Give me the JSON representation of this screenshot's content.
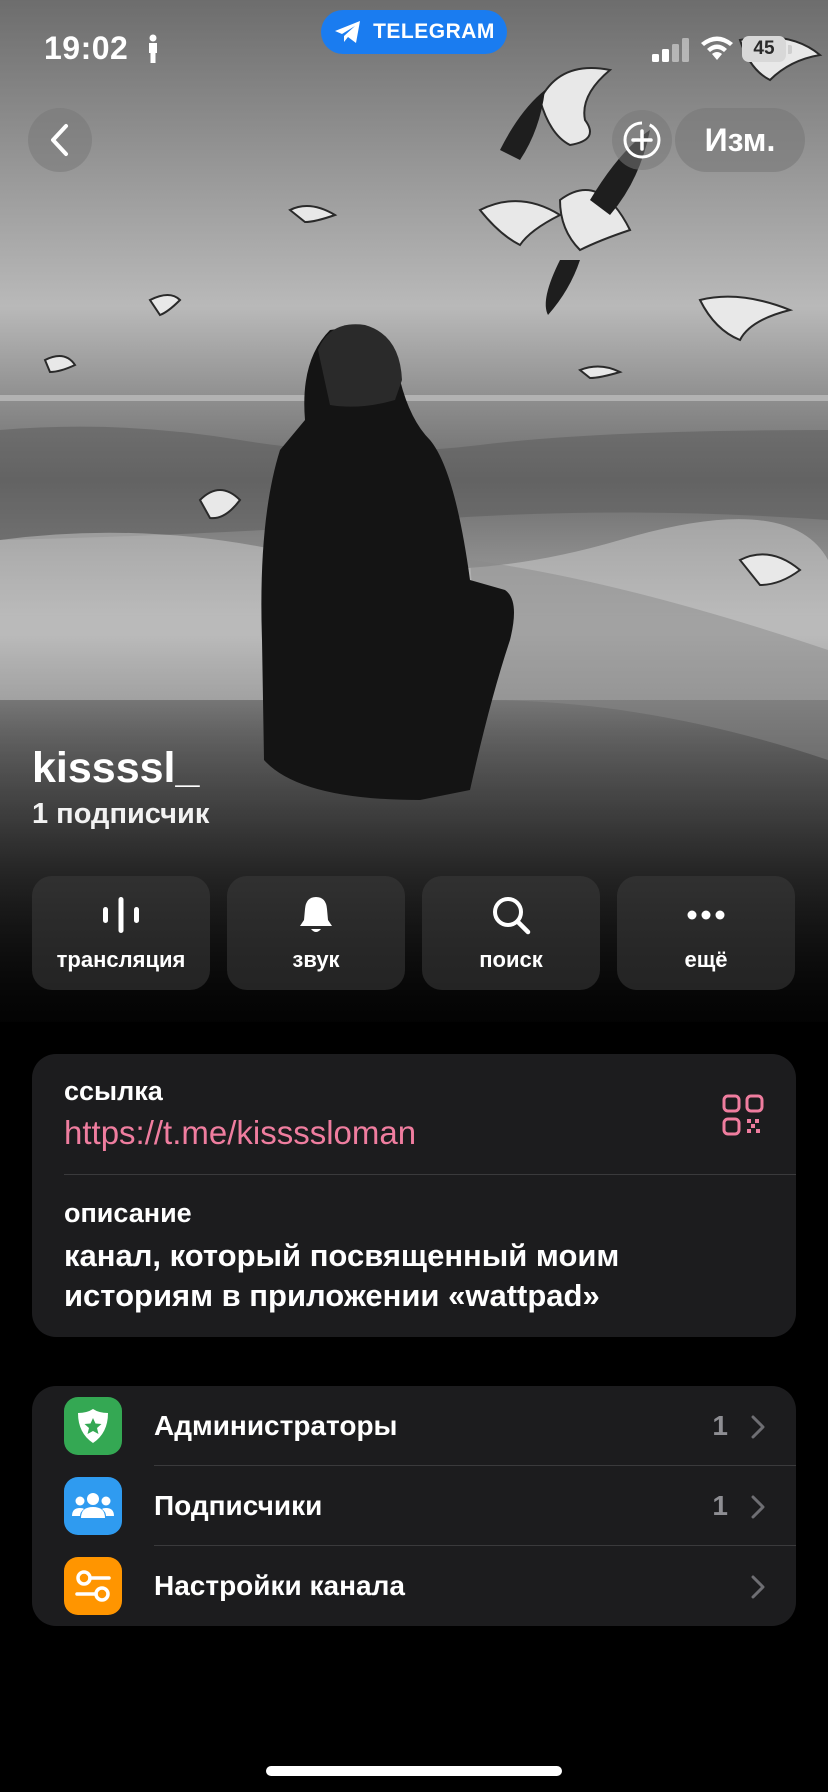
{
  "status_bar": {
    "time": "19:02",
    "app_pill": "TELEGRAM",
    "battery": "45"
  },
  "nav": {
    "edit_label": "Изм."
  },
  "channel": {
    "name": "kissssl_",
    "subscribers": "1 подписчик"
  },
  "actions": [
    {
      "label": "трансляция",
      "icon": "live-stream-icon"
    },
    {
      "label": "звук",
      "icon": "bell-icon"
    },
    {
      "label": "поиск",
      "icon": "search-icon"
    },
    {
      "label": "ещё",
      "icon": "more-icon"
    }
  ],
  "info": {
    "link_title": "ссылка",
    "link_value": "https://t.me/kisssslomаn",
    "description_title": "описание",
    "description_value": "канал, который посвященный моим историям в приложении «wattpad»"
  },
  "settings": [
    {
      "label": "Администраторы",
      "count": "1",
      "icon": "admin-shield-icon",
      "color": "#34a853"
    },
    {
      "label": "Подписчики",
      "count": "1",
      "icon": "subscribers-icon",
      "color": "#2f9bf0"
    },
    {
      "label": "Настройки канала",
      "count": "",
      "icon": "channel-settings-icon",
      "color": "#ff9500"
    }
  ],
  "colors": {
    "accent_link": "#ef7d9f",
    "telegram_blue": "#1a7cf0",
    "card_bg": "#1c1c1e"
  }
}
